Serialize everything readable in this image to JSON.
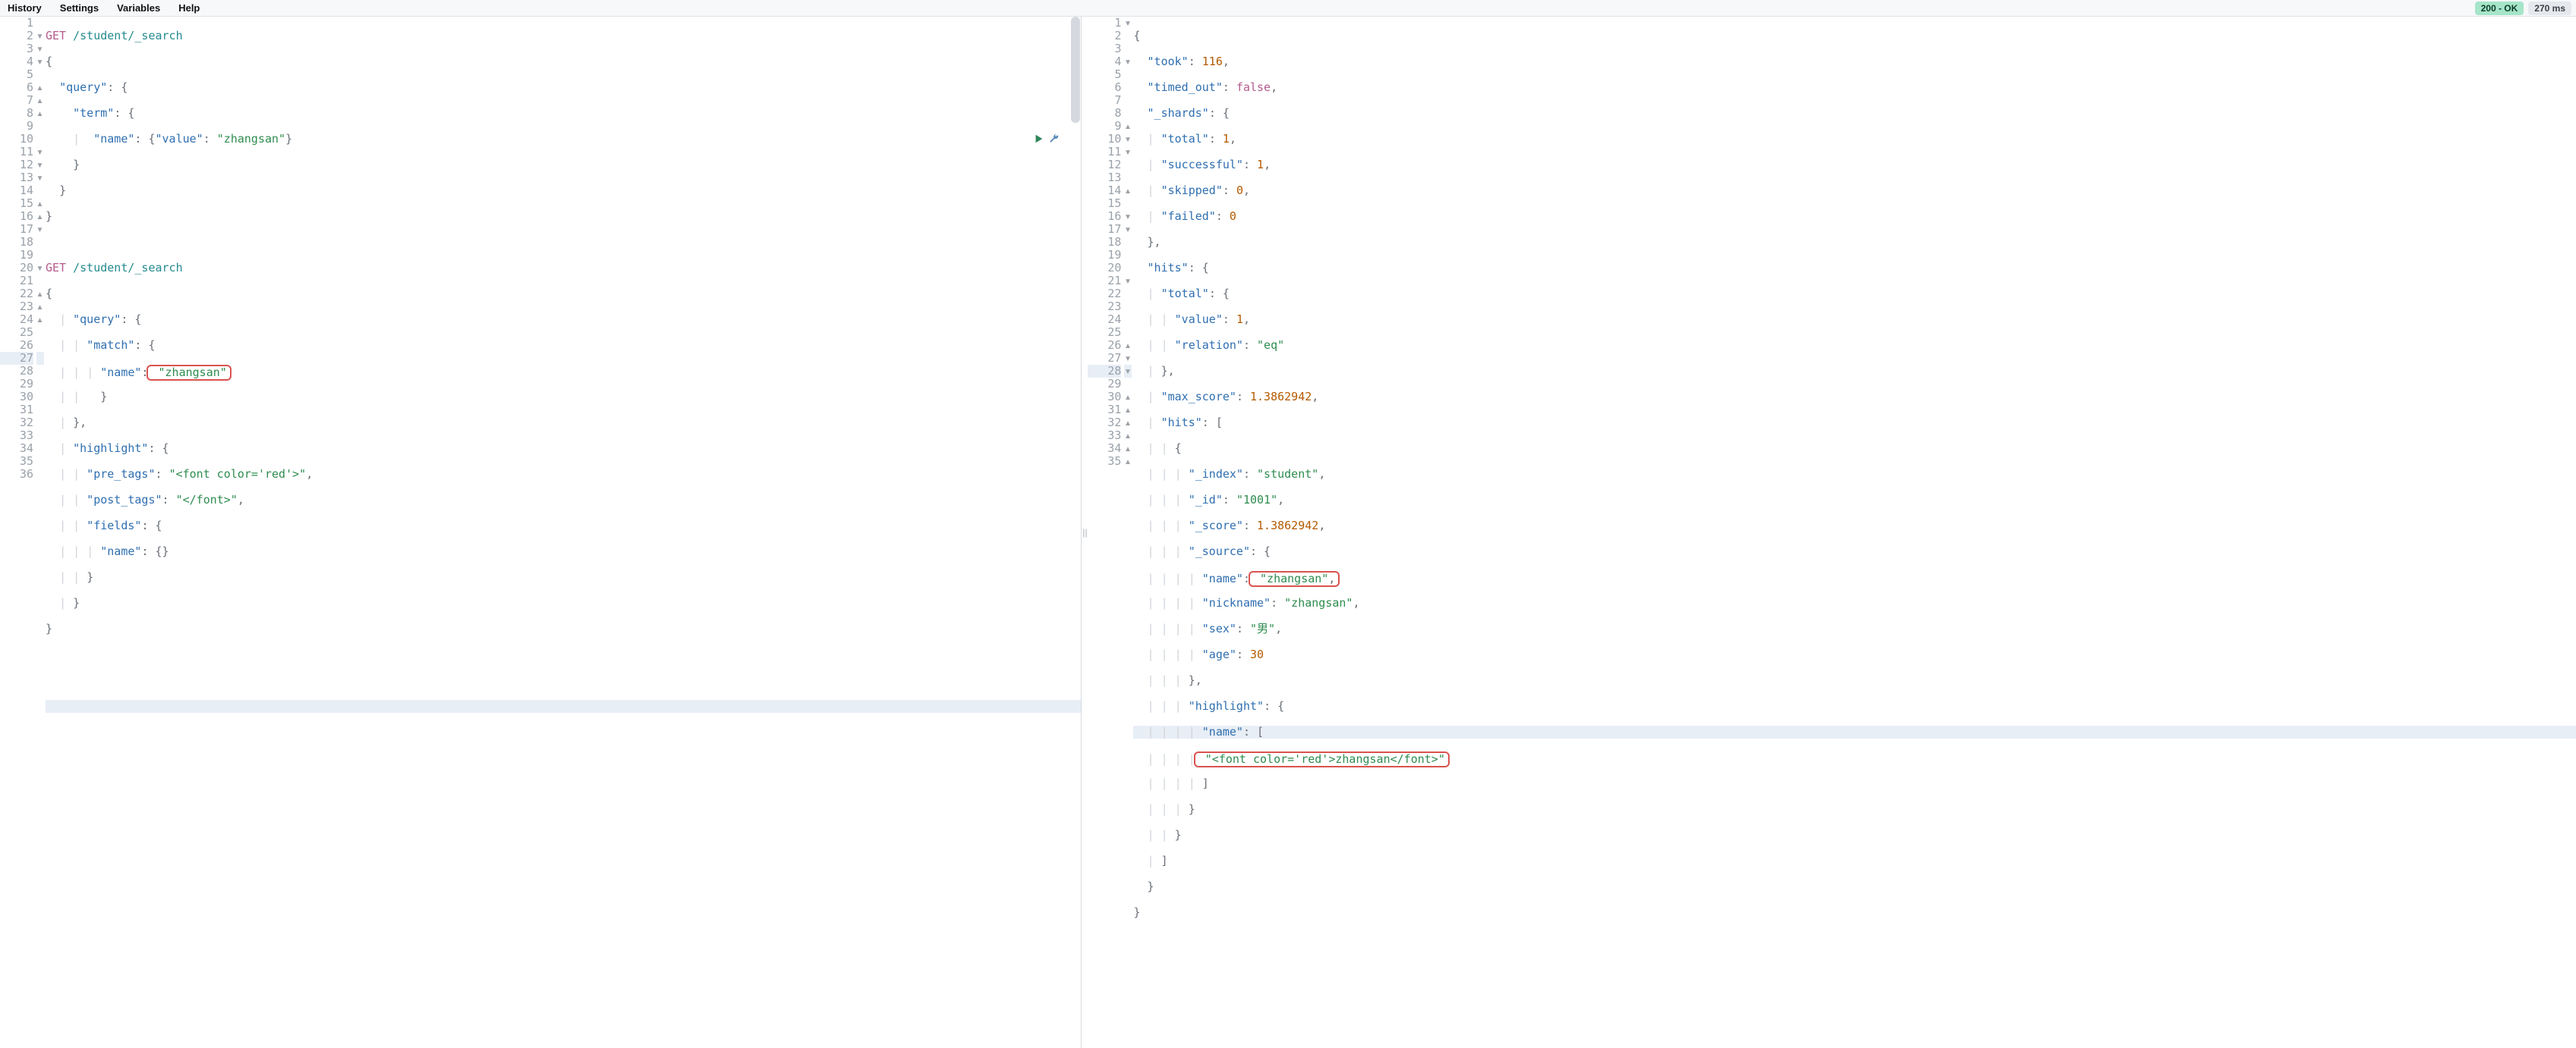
{
  "menu": {
    "history": "History",
    "settings": "Settings",
    "variables": "Variables",
    "help": "Help"
  },
  "status": {
    "ok_label": "200 - OK",
    "time_label": "270 ms"
  },
  "splitter_glyph": "||",
  "request": {
    "method1": "GET",
    "path1": "/student/_search",
    "method2": "GET",
    "path2": "/student/_search",
    "key_query": "\"query\"",
    "key_term": "\"term\"",
    "key_name": "\"name\"",
    "key_value": "\"value\"",
    "val_zhangsan": "\"zhangsan\"",
    "key_match": "\"match\"",
    "key_highlight": "\"highlight\"",
    "key_pretags": "\"pre_tags\"",
    "val_pretags": "\"<font color='red'>\"",
    "key_posttags": "\"post_tags\"",
    "val_posttags": "\"</font>\"",
    "key_fields": "\"fields\"",
    "empty_braces": "{}"
  },
  "response": {
    "key_took": "\"took\"",
    "val_took": "116",
    "key_timed_out": "\"timed_out\"",
    "val_false": "false",
    "key_shards": "\"_shards\"",
    "key_total": "\"total\"",
    "val_1": "1",
    "key_successful": "\"successful\"",
    "key_skipped": "\"skipped\"",
    "val_0": "0",
    "key_failed": "\"failed\"",
    "key_hits": "\"hits\"",
    "key_value": "\"value\"",
    "key_relation": "\"relation\"",
    "val_eq": "\"eq\"",
    "key_maxscore": "\"max_score\"",
    "val_maxscore": "1.3862942",
    "key_index": "\"_index\"",
    "val_index": "\"student\"",
    "key_id": "\"_id\"",
    "val_id": "\"1001\"",
    "key_score": "\"_score\"",
    "key_source": "\"_source\"",
    "key_name": "\"name\"",
    "val_zhangsan": "\"zhangsan\"",
    "key_nickname": "\"nickname\"",
    "key_sex": "\"sex\"",
    "val_sex": "\"男\"",
    "key_age": "\"age\"",
    "val_age": "30",
    "key_highlight": "\"highlight\"",
    "val_hl_name": "\"<font color='red'>zhangsan</font>\""
  },
  "gutter": {
    "left_lines": [
      "1",
      "2",
      "3",
      "4",
      "5",
      "6",
      "7",
      "8",
      "9",
      "10",
      "11",
      "12",
      "13",
      "14",
      "15",
      "16",
      "17",
      "18",
      "19",
      "20",
      "21",
      "22",
      "23",
      "24",
      "25",
      "26",
      "27",
      "28",
      "29",
      "30",
      "31",
      "32",
      "33",
      "34",
      "35",
      "36"
    ],
    "left_folds": [
      "",
      "▾",
      "▾",
      "▾",
      "",
      "▴",
      "▴",
      "▴",
      "",
      "",
      "▾",
      "▾",
      "▾",
      "",
      "▴",
      "▴",
      "▾",
      "",
      "",
      "▾",
      "",
      "▴",
      "▴",
      "▴",
      "",
      "",
      "",
      "",
      "",
      "",
      "",
      "",
      "",
      "",
      "",
      ""
    ],
    "right_lines": [
      "1",
      "2",
      "3",
      "4",
      "5",
      "6",
      "7",
      "8",
      "9",
      "10",
      "11",
      "12",
      "13",
      "14",
      "15",
      "16",
      "17",
      "18",
      "19",
      "20",
      "21",
      "22",
      "23",
      "24",
      "25",
      "26",
      "27",
      "28",
      "29",
      "30",
      "31",
      "32",
      "33",
      "34",
      "35"
    ],
    "right_folds": [
      "▾",
      "",
      "",
      "▾",
      "",
      "",
      "",
      "",
      "▴",
      "▾",
      "▾",
      "",
      "",
      "▴",
      "",
      "▾",
      "▾",
      "",
      "",
      "",
      "▾",
      "",
      "",
      "",
      "",
      "▴",
      "▾",
      "▾",
      "",
      "▴",
      "▴",
      "▴",
      "▴",
      "▴",
      "▴"
    ]
  },
  "active_left_line": 27,
  "active_right_line": 28
}
